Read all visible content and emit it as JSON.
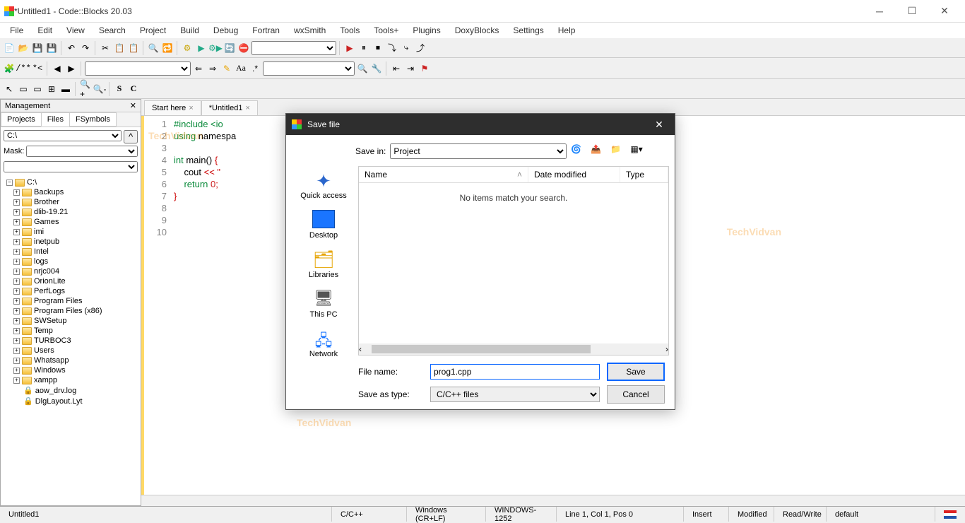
{
  "window": {
    "title": "*Untitled1 - Code::Blocks 20.03"
  },
  "menu": [
    "File",
    "Edit",
    "View",
    "Search",
    "Project",
    "Build",
    "Debug",
    "Fortran",
    "wxSmith",
    "Tools",
    "Tools+",
    "Plugins",
    "DoxyBlocks",
    "Settings",
    "Help"
  ],
  "management": {
    "title": "Management",
    "tabs": {
      "projects": "Projects",
      "files": "Files",
      "fsymbols": "FSymbols"
    },
    "drive_value": "C:\\",
    "mask_label": "Mask:",
    "tree": [
      {
        "label": "C:\\",
        "root": true
      },
      {
        "label": "Backups"
      },
      {
        "label": "Brother"
      },
      {
        "label": "dlib-19.21"
      },
      {
        "label": "Games"
      },
      {
        "label": "imi"
      },
      {
        "label": "inetpub"
      },
      {
        "label": "Intel"
      },
      {
        "label": "logs"
      },
      {
        "label": "nrjc004"
      },
      {
        "label": "OrionLite"
      },
      {
        "label": "PerfLogs"
      },
      {
        "label": "Program Files"
      },
      {
        "label": "Program Files (x86)"
      },
      {
        "label": "SWSetup"
      },
      {
        "label": "Temp"
      },
      {
        "label": "TURBOC3"
      },
      {
        "label": "Users"
      },
      {
        "label": "Whatsapp"
      },
      {
        "label": "Windows"
      },
      {
        "label": "xampp"
      }
    ],
    "files": [
      "aow_drv.log",
      "DlgLayout.Lyt"
    ]
  },
  "editor_tabs": [
    {
      "label": "Start here"
    },
    {
      "label": "*Untitled1"
    }
  ],
  "code": {
    "line_numbers": [
      "1",
      "2",
      "3",
      "4",
      "5",
      "6",
      "7",
      "8",
      "9",
      "10"
    ],
    "l1_a": "#include ",
    "l1_b": "<io",
    "l2_a": "using",
    "l2_b": " namespa",
    "l4_a": "int",
    "l4_b": " main",
    "l4_c": "()",
    "l4_d": " {",
    "l5_a": "    cout ",
    "l5_b": "<< \"",
    "l6_a": "    ",
    "l6_b": "return",
    "l6_c": " ",
    "l6_d": "0",
    "l6_e": ";",
    "l7": "}"
  },
  "save_dialog": {
    "title": "Save file",
    "save_in_label": "Save in:",
    "save_in_value": "Project",
    "places": {
      "quick_access": "Quick access",
      "desktop": "Desktop",
      "libraries": "Libraries",
      "this_pc": "This PC",
      "network": "Network"
    },
    "columns": {
      "name": "Name",
      "date": "Date modified",
      "type": "Type"
    },
    "empty_msg": "No items match your search.",
    "file_name_label": "File name:",
    "file_name_value": "prog1.cpp",
    "save_as_type_label": "Save as type:",
    "save_as_type_value": "C/C++ files",
    "save_btn": "Save",
    "cancel_btn": "Cancel"
  },
  "statusbar": {
    "file": "Untitled1",
    "lang": "C/C++",
    "eol": "Windows (CR+LF)",
    "enc": "WINDOWS-1252",
    "pos": "Line 1, Col 1, Pos 0",
    "ins": "Insert",
    "mod": "Modified",
    "rw": "Read/Write",
    "profile": "default"
  },
  "watermark": "TechVidvan"
}
